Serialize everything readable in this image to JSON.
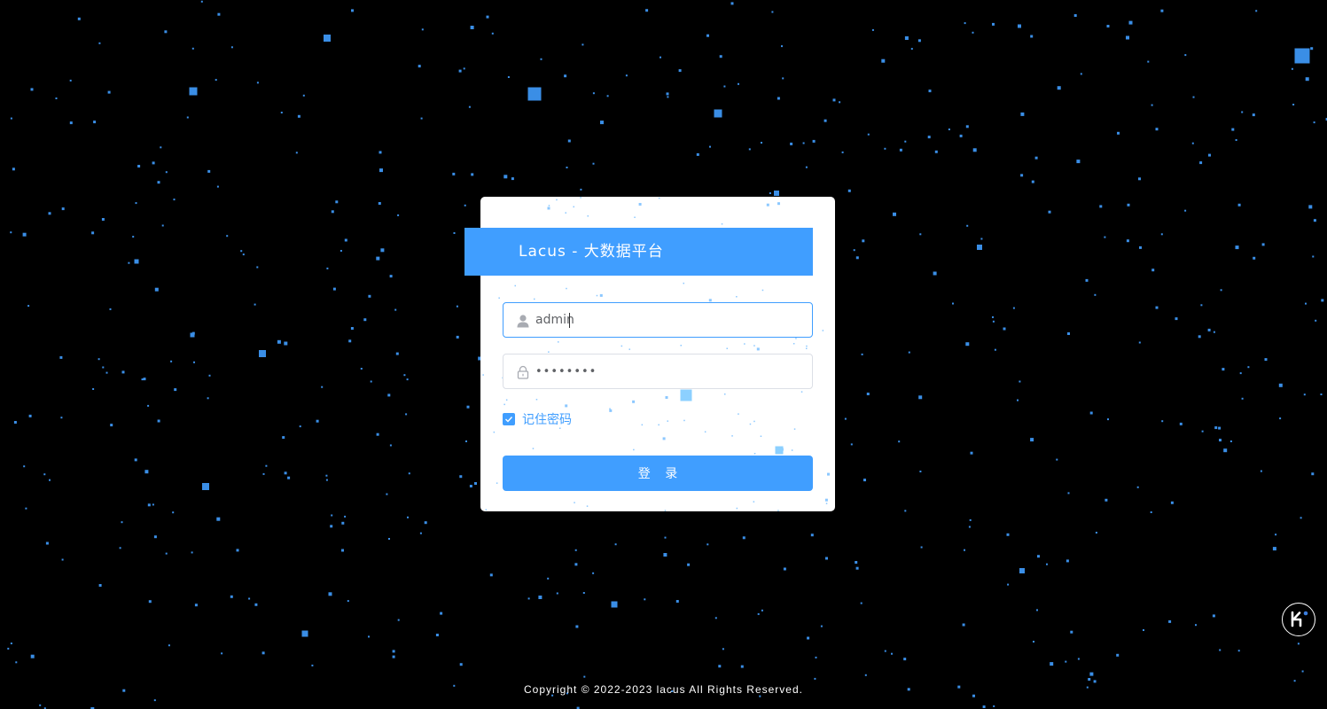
{
  "app": {
    "title": "Lacus  -  大数据平台"
  },
  "login_form": {
    "username": {
      "value": "admin",
      "icon": "user-icon"
    },
    "password": {
      "value": "••••••••",
      "icon": "lock-icon"
    },
    "remember": {
      "label": "记住密码",
      "checked": true
    },
    "submit_label": "登 录"
  },
  "footer": {
    "copyright": "Copyright © 2022-2023 lacus All Rights Reserved."
  },
  "floating_button": {
    "icon": "k-logo-icon"
  },
  "colors": {
    "background": "#000000",
    "accent": "#409eff",
    "star": "#3a8ee6",
    "card": "#ffffff"
  }
}
